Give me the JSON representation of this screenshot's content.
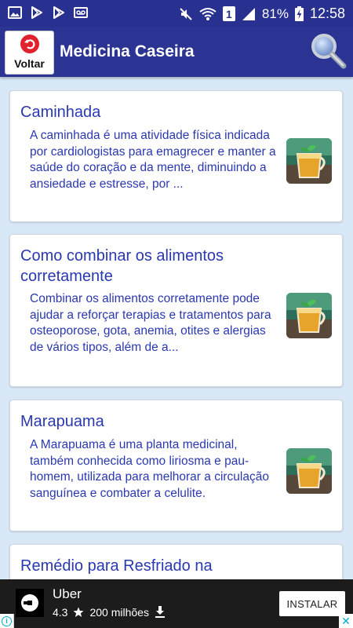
{
  "status_bar": {
    "battery_percent": "81%",
    "time": "12:58",
    "sim_slot": "1",
    "left_icons": [
      "image-icon",
      "play-store-icon",
      "play-store-icon",
      "voicemail-icon"
    ],
    "right_icons": [
      "mute-icon",
      "wifi-icon",
      "sim-signal-icon",
      "signal-icon",
      "battery-charging-icon"
    ]
  },
  "appbar": {
    "back_label": "Voltar",
    "title": "Medicina Caseira",
    "search_icon": "search-icon"
  },
  "articles": [
    {
      "title": "Caminhada",
      "description": "A caminhada é uma atividade física indicada por cardiologistas para emagrecer e manter a saúde do coração e da mente, diminuindo a ansiedade e estresse, por ...",
      "thumbnail_icon": "tea-cup-icon"
    },
    {
      "title": "Como combinar os alimentos corretamente",
      "description": "Combinar os alimentos corretamente pode ajudar a reforçar terapias e tratamentos para osteoporose, gota, anemia, otites e alergias de vários tipos, além de a...",
      "thumbnail_icon": "tea-cup-icon"
    },
    {
      "title": "Marapuama",
      "description": "A Marapuama é uma planta medicinal, também conhecida como liriosma e pau-homem, utilizada para melhorar a circulação sanguínea e combater a celulite.",
      "thumbnail_icon": "tea-cup-icon"
    },
    {
      "title": "Remédio para Resfriado na",
      "description": "",
      "thumbnail_icon": "tea-cup-icon"
    }
  ],
  "ad": {
    "app_name": "Uber",
    "rating": "4.3",
    "downloads": "200 milhões",
    "install_label": "INSTALAR",
    "info_icon": "info-icon",
    "close_icon": "close-icon"
  },
  "colors": {
    "primary": "#2b3493",
    "status_bar": "#28318f",
    "background": "#d9e8f7",
    "text_accent": "#2a38b0",
    "back_icon": "#e0222e"
  }
}
